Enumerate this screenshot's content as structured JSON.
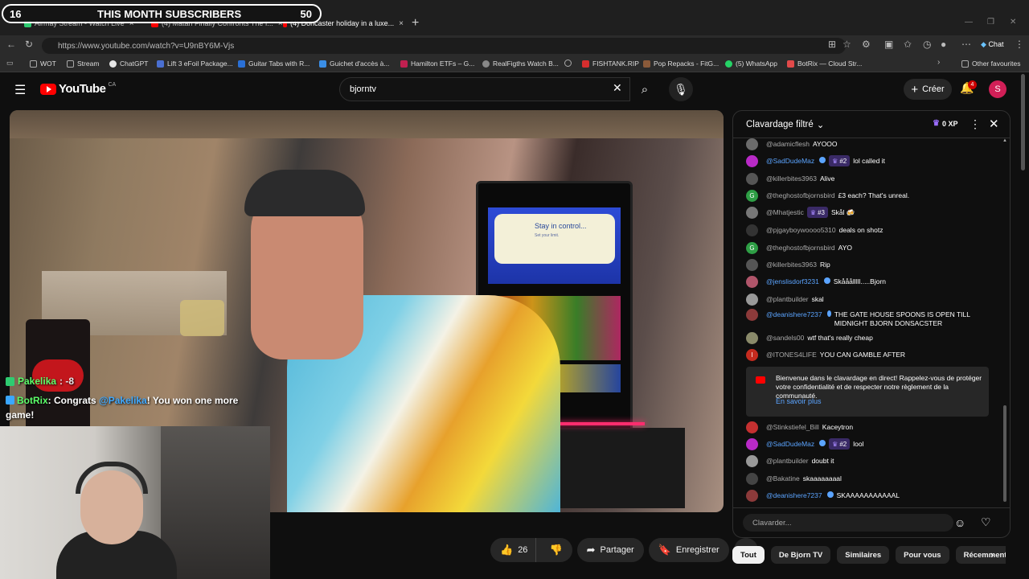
{
  "overlay": {
    "subs_left": "16",
    "subs_title": "THIS MONTH SUBSCRIBERS",
    "subs_right": "50"
  },
  "browser": {
    "tabs": [
      {
        "label": "Airmay Stream - Watch Live",
        "color": "#2ecc71"
      },
      {
        "label": "(4) Matan Finally Confronts The I...",
        "color": "#ff0000"
      },
      {
        "label": "(4) Doncaster holiday in a luxe...",
        "color": "#ff0000"
      }
    ],
    "url": "https://www.youtube.com/watch?v=U9nBY6M-Vjs",
    "copilot": "Chat",
    "bookmarks": [
      {
        "label": "WOT",
        "color": "#666"
      },
      {
        "label": "Stream",
        "color": "#666"
      },
      {
        "label": "ChatGPT",
        "color": "#e6e6e6"
      },
      {
        "label": "Lift 3 eFoil Package...",
        "color": "#4a6fd1"
      },
      {
        "label": "Guitar Tabs with R...",
        "color": "#2a70d6"
      },
      {
        "label": "Guichet d'accès à...",
        "color": "#3a8ee6"
      },
      {
        "label": "Hamilton ETFs – G...",
        "color": "#c02050"
      },
      {
        "label": "RealFigths Watch B...",
        "color": "#888"
      },
      {
        "label": "",
        "color": "#888"
      },
      {
        "label": "FISHTANK.RIP",
        "color": "#d62e2e"
      },
      {
        "label": "Pop Repacks - FitG...",
        "color": "#8a5a3a"
      },
      {
        "label": "(5) WhatsApp",
        "color": "#25d366"
      },
      {
        "label": "BotRix — Cloud Str...",
        "color": "#e24a4a"
      }
    ],
    "other_favourites": "Other favourites"
  },
  "youtube": {
    "logo": "YouTube",
    "country": "CA",
    "search_value": "bjorntv",
    "create_label": "Créer",
    "notif_count": "4",
    "avatar_letter": "S"
  },
  "video_overlay": {
    "bubble_title": "Stay in control...",
    "bubble_sub": "Set your limit.",
    "pakelika_name": "Pakelika",
    "pakelika_text": ": -8",
    "botrix_name": "BotRix",
    "botrix_pre": ": Congrats ",
    "botrix_mention": "@Pakelika",
    "botrix_post": "! You won one more game!"
  },
  "actions": {
    "likes": "26",
    "share": "Partager",
    "save": "Enregistrer"
  },
  "chat": {
    "title": "Clavardage filtré",
    "xp": "0 XP",
    "messages": [
      {
        "author": "@adamicflesh",
        "text": "AYOOO",
        "member": false,
        "rank": "",
        "av": "#6b6b6b",
        "avtxt": ""
      },
      {
        "author": "@SadDudeMaz",
        "text": "lol called it",
        "member": true,
        "rank": "#2",
        "av": "#b92ac7",
        "avtxt": ""
      },
      {
        "author": "@killerbites3963",
        "text": "Alive",
        "member": false,
        "rank": "",
        "av": "#555",
        "avtxt": ""
      },
      {
        "author": "@theghostofbjornsbird",
        "text": "£3 each? That's unreal.",
        "member": false,
        "rank": "",
        "av": "#2e9e45",
        "avtxt": "G"
      },
      {
        "author": "@Mhatjestic",
        "text": "Skål 🍻",
        "member": false,
        "rank": "#3",
        "av": "#777",
        "avtxt": ""
      },
      {
        "author": "@pjgayboywoooo5310",
        "text": "deals on shotz",
        "member": false,
        "rank": "",
        "av": "#333",
        "avtxt": ""
      },
      {
        "author": "@theghostofbjornsbird",
        "text": "AYO",
        "member": false,
        "rank": "",
        "av": "#2e9e45",
        "avtxt": "G"
      },
      {
        "author": "@killerbites3963",
        "text": "Rip",
        "member": false,
        "rank": "",
        "av": "#555",
        "avtxt": ""
      },
      {
        "author": "@jenslisdorf3231",
        "text": "Skååålllll.....Bjorn",
        "member": true,
        "rank": "",
        "av": "#b0556a",
        "avtxt": ""
      },
      {
        "author": "@plantbuilder",
        "text": "skal",
        "member": false,
        "rank": "",
        "av": "#999",
        "avtxt": ""
      },
      {
        "author": "@deanishere7237",
        "text": "THE GATE HOUSE SPOONS IS OPEN TILL MIDNIGHT BJORN DONSACSTER",
        "member": true,
        "rank": "",
        "av": "#8c3a3a",
        "avtxt": ""
      },
      {
        "author": "@sandels00",
        "text": "wtf that's really cheap",
        "member": false,
        "rank": "",
        "av": "#8a8a6a",
        "avtxt": ""
      },
      {
        "author": "@ITONES4LIFE",
        "text": "YOU CAN GAMBLE AFTER",
        "member": false,
        "rank": "",
        "av": "#c62b1f",
        "avtxt": "I"
      },
      {
        "author": "@Stinkstiefel_Bill",
        "text": "Kaceytron",
        "member": false,
        "rank": "",
        "av": "#c43030",
        "avtxt": ""
      },
      {
        "author": "@SadDudeMaz",
        "text": "lool",
        "member": true,
        "rank": "#2",
        "av": "#b92ac7",
        "avtxt": ""
      },
      {
        "author": "@plantbuilder",
        "text": "doubt it",
        "member": false,
        "rank": "",
        "av": "#999",
        "avtxt": ""
      },
      {
        "author": "@Bakatine",
        "text": "skaaaaaaaal",
        "member": false,
        "rank": "",
        "av": "#444",
        "avtxt": ""
      },
      {
        "author": "@deanishere7237",
        "text": "SKAAAAAAAAAAAL",
        "member": true,
        "rank": "",
        "av": "#8c3a3a",
        "avtxt": ""
      }
    ],
    "system_message": "Bienvenue dans le clavardage en direct! Rappelez-vous de protéger votre confidentialité et de respecter notre règlement de la communauté.",
    "system_link": "En savoir plus",
    "input_placeholder": "Clavarder..."
  },
  "chips": [
    "Tout",
    "De Bjorn TV",
    "Similaires",
    "Pour vous",
    "Récemment mis"
  ]
}
